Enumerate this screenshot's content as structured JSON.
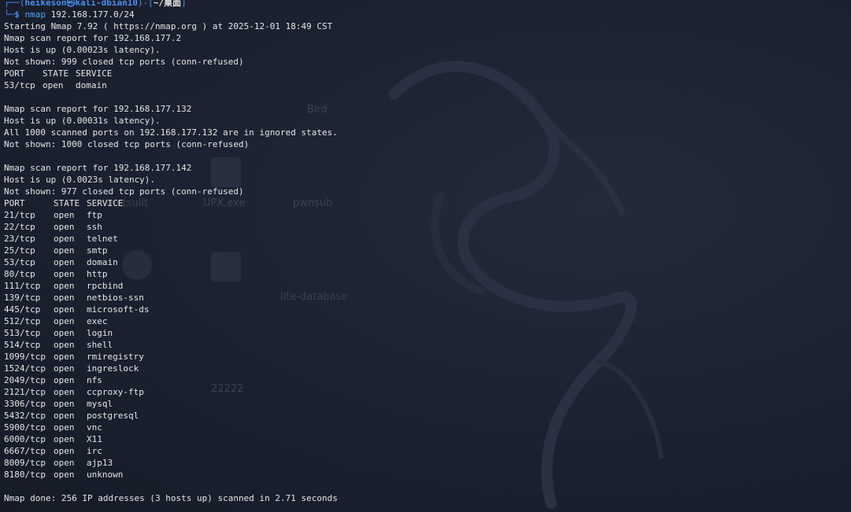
{
  "desktop_bg": {
    "color": "#1c2230",
    "icons": [
      {
        "label": "metsulit"
      },
      {
        "label": "UPX.exe"
      },
      {
        "label": "pwnsub"
      },
      {
        "label": "lite-database"
      },
      {
        "label": "22222"
      },
      {
        "label": "Bird"
      }
    ]
  },
  "prompt": {
    "frame_left": "┌──(",
    "user_host": "heikeson㉿kali-dbian10",
    "frame_mid": ")-[",
    "dir": "~/桌面",
    "frame_right": "]",
    "frame_bottom": "└─",
    "dollar": "$",
    "cmd": "nmap",
    "args": "192.168.177.0/24"
  },
  "output": {
    "starting": "Starting Nmap 7.92 ( https://nmap.org ) at 2025-12-01 18:49 CST",
    "hosts": [
      {
        "report": "Nmap scan report for 192.168.177.2",
        "up": "Host is up (0.00023s latency).",
        "not_shown": "Not shown: 999 closed tcp ports (conn-refused)",
        "header": {
          "port": "PORT",
          "state": "STATE",
          "service": "SERVICE"
        },
        "ports": [
          {
            "port": "53/tcp",
            "state": "open",
            "service": "domain"
          }
        ]
      },
      {
        "report": "Nmap scan report for 192.168.177.132",
        "up": "Host is up (0.00031s latency).",
        "ignored": "All 1000 scanned ports on 192.168.177.132 are in ignored states.",
        "not_shown": "Not shown: 1000 closed tcp ports (conn-refused)"
      },
      {
        "report": "Nmap scan report for 192.168.177.142",
        "up": "Host is up (0.0023s latency).",
        "not_shown": "Not shown: 977 closed tcp ports (conn-refused)",
        "header": {
          "port": "PORT",
          "state": "STATE",
          "service": "SERVICE"
        },
        "ports": [
          {
            "port": "21/tcp",
            "state": "open",
            "service": "ftp"
          },
          {
            "port": "22/tcp",
            "state": "open",
            "service": "ssh"
          },
          {
            "port": "23/tcp",
            "state": "open",
            "service": "telnet"
          },
          {
            "port": "25/tcp",
            "state": "open",
            "service": "smtp"
          },
          {
            "port": "53/tcp",
            "state": "open",
            "service": "domain"
          },
          {
            "port": "80/tcp",
            "state": "open",
            "service": "http"
          },
          {
            "port": "111/tcp",
            "state": "open",
            "service": "rpcbind"
          },
          {
            "port": "139/tcp",
            "state": "open",
            "service": "netbios-ssn"
          },
          {
            "port": "445/tcp",
            "state": "open",
            "service": "microsoft-ds"
          },
          {
            "port": "512/tcp",
            "state": "open",
            "service": "exec"
          },
          {
            "port": "513/tcp",
            "state": "open",
            "service": "login"
          },
          {
            "port": "514/tcp",
            "state": "open",
            "service": "shell"
          },
          {
            "port": "1099/tcp",
            "state": "open",
            "service": "rmiregistry"
          },
          {
            "port": "1524/tcp",
            "state": "open",
            "service": "ingreslock"
          },
          {
            "port": "2049/tcp",
            "state": "open",
            "service": "nfs"
          },
          {
            "port": "2121/tcp",
            "state": "open",
            "service": "ccproxy-ftp"
          },
          {
            "port": "3306/tcp",
            "state": "open",
            "service": "mysql"
          },
          {
            "port": "5432/tcp",
            "state": "open",
            "service": "postgresql"
          },
          {
            "port": "5900/tcp",
            "state": "open",
            "service": "vnc"
          },
          {
            "port": "6000/tcp",
            "state": "open",
            "service": "X11"
          },
          {
            "port": "6667/tcp",
            "state": "open",
            "service": "irc"
          },
          {
            "port": "8009/tcp",
            "state": "open",
            "service": "ajp13"
          },
          {
            "port": "8180/tcp",
            "state": "open",
            "service": "unknown"
          }
        ]
      }
    ],
    "done": "Nmap done: 256 IP addresses (3 hosts up) scanned in 2.71 seconds"
  },
  "colors": {
    "prompt_blue": "#4a8ff0",
    "text": "#e6e6e6",
    "background": "#1c2230"
  }
}
